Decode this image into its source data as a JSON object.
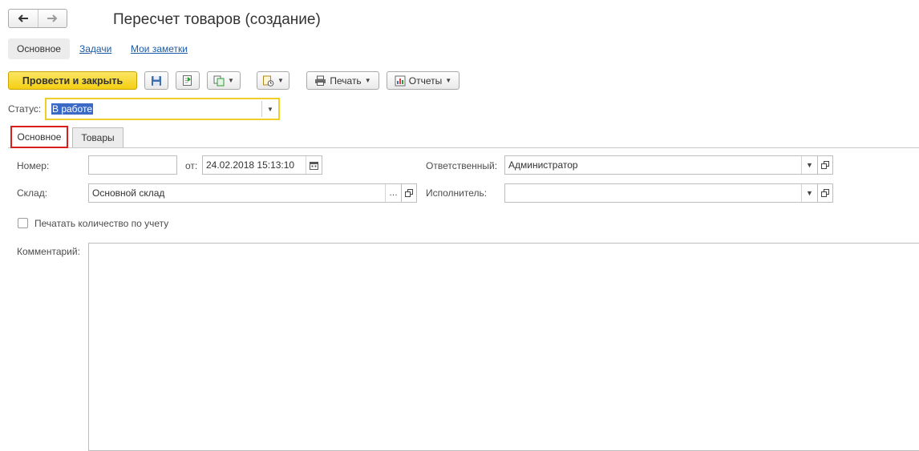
{
  "window": {
    "title": "Пересчет товаров (создание)"
  },
  "sections": {
    "active": "Основное",
    "links": [
      "Задачи",
      "Мои заметки"
    ]
  },
  "toolbar": {
    "post_close_label": "Провести и закрыть",
    "print_label": "Печать",
    "reports_label": "Отчеты"
  },
  "status": {
    "label": "Статус:",
    "value": "В работе"
  },
  "tabs": [
    {
      "label": "Основное",
      "active": true
    },
    {
      "label": "Товары",
      "active": false
    }
  ],
  "form": {
    "number_label": "Номер:",
    "number_value": "",
    "date_from_label": "от:",
    "date_value": "24.02.2018 15:13:10",
    "responsible_label": "Ответственный:",
    "responsible_value": "Администратор",
    "warehouse_label": "Склад:",
    "warehouse_value": "Основной склад",
    "executor_label": "Исполнитель:",
    "executor_value": "",
    "print_qty_label": "Печатать количество по учету",
    "print_qty_checked": false,
    "comment_label": "Комментарий:",
    "comment_value": ""
  },
  "icons": {
    "back": "arrow-left-icon",
    "forward": "arrow-right-icon",
    "save": "floppy-disk-icon",
    "post": "document-post-icon",
    "create_based": "create-based-on-icon",
    "structure": "document-structure-icon",
    "print": "printer-icon",
    "reports": "report-chart-icon",
    "calendar": "calendar-icon",
    "open": "open-window-icon"
  },
  "colors": {
    "primary_button": "#f4cf12",
    "link": "#1a5ba8",
    "focus_border": "#f0ce28",
    "highlight_tab_border": "#d91e1e",
    "selection": "#3b6ac6"
  }
}
